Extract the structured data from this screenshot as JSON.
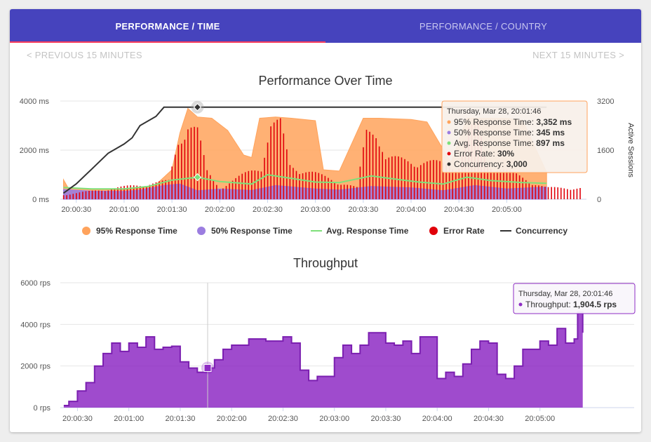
{
  "tabs": [
    {
      "label": "PERFORMANCE / TIME",
      "active": true
    },
    {
      "label": "PERFORMANCE / COUNTRY",
      "active": false
    }
  ],
  "pager": {
    "previous": "< PREVIOUS 15 MINUTES",
    "next": "NEXT 15 MINUTES >"
  },
  "colors": {
    "tab_bar": "#4643bd",
    "tab_indicator": "#ff3b5c",
    "p95": "#ffa35c",
    "p50": "#9b7de0",
    "avg": "#7ee07a",
    "error": "#e0000a",
    "concurrency": "#333333",
    "throughput": "#8e2cc4"
  },
  "legend_icons": {
    "p95": "circle-icon",
    "p50": "circle-icon",
    "avg": "line-icon",
    "error": "circle-icon",
    "concurrency": "line-icon"
  },
  "tooltips": {
    "performance": {
      "date": "Thursday, Mar 28, 20:01:46",
      "rows": [
        {
          "label": "95% Response Time: ",
          "value": "3,352 ms",
          "color": "#ffa35c"
        },
        {
          "label": "50% Response Time: ",
          "value": "345 ms",
          "color": "#9b7de0"
        },
        {
          "label": "Avg. Response Time: ",
          "value": "897 ms",
          "color": "#7ee07a"
        },
        {
          "label": "Error Rate: ",
          "value": "30%",
          "color": "#e0000a"
        },
        {
          "label": "Concurrency: ",
          "value": "3,000",
          "color": "#333333"
        }
      ]
    },
    "throughput": {
      "date": "Thursday, Mar 28, 20:01:46",
      "rows": [
        {
          "label": "Throughput: ",
          "value": "1,904.5 rps",
          "color": "#8e2cc4"
        }
      ]
    }
  },
  "chart_data": [
    {
      "type": "area",
      "title": "Performance Over Time",
      "x_tick_labels": [
        "20:00:30",
        "20:01:00",
        "20:01:30",
        "20:02:00",
        "20:02:30",
        "20:03:00",
        "20:03:30",
        "20:04:00",
        "20:04:30",
        "20:05:00"
      ],
      "y_left": {
        "unit": "ms",
        "tick_labels": [
          "0 ms",
          "2000 ms",
          "4000 ms"
        ],
        "ylim": [
          0,
          4000
        ]
      },
      "y_right": {
        "label": "Active Sessions",
        "tick_labels": [
          "0",
          "1600",
          "3200"
        ],
        "ylim": [
          0,
          3200
        ]
      },
      "x_range_seconds": [
        20,
        350
      ],
      "grid": true,
      "legend_position": "bottom",
      "legend": [
        {
          "key": "p95",
          "name": "95% Response Time"
        },
        {
          "key": "p50",
          "name": "50% Response Time"
        },
        {
          "key": "avg",
          "name": "Avg. Response Time"
        },
        {
          "key": "error",
          "name": "Error Rate"
        },
        {
          "key": "concurrency",
          "name": "Concurrency"
        }
      ],
      "series": [
        {
          "key": "p95",
          "name": "95% Response Time",
          "x": [
            "20:00:22",
            "20:00:25",
            "20:00:40",
            "20:01:00",
            "20:01:10",
            "20:01:20",
            "20:01:30",
            "20:01:35",
            "20:01:40",
            "20:01:46",
            "20:01:55",
            "20:02:05",
            "20:02:15",
            "20:02:20",
            "20:02:25",
            "20:02:35",
            "20:02:45",
            "20:03:00",
            "20:03:05",
            "20:03:15",
            "20:03:30",
            "20:03:40",
            "20:04:00",
            "20:04:10",
            "20:04:25",
            "20:04:35",
            "20:04:40",
            "20:05:00",
            "20:05:10",
            "20:05:25"
          ],
          "y": [
            800,
            450,
            400,
            400,
            450,
            600,
            1200,
            2700,
            3700,
            3352,
            3300,
            2800,
            1800,
            1700,
            3300,
            3350,
            3300,
            3200,
            1200,
            1150,
            3300,
            3300,
            3250,
            3150,
            1500,
            3300,
            3300,
            3300,
            3200,
            1100
          ]
        },
        {
          "key": "p50",
          "name": "50% Response Time",
          "x": [
            "20:00:22",
            "20:00:40",
            "20:01:00",
            "20:01:10",
            "20:01:25",
            "20:01:35",
            "20:01:46",
            "20:02:00",
            "20:02:20",
            "20:02:35",
            "20:03:00",
            "20:03:15",
            "20:03:35",
            "20:04:00",
            "20:04:20",
            "20:04:40",
            "20:05:00",
            "20:05:25"
          ],
          "y": [
            400,
            330,
            320,
            380,
            560,
            620,
            345,
            420,
            360,
            560,
            420,
            380,
            520,
            470,
            350,
            560,
            420,
            500
          ]
        },
        {
          "key": "avg",
          "name": "Avg. Response Time",
          "x": [
            "20:00:22",
            "20:00:40",
            "20:01:00",
            "20:01:15",
            "20:01:30",
            "20:01:46",
            "20:02:00",
            "20:02:20",
            "20:02:30",
            "20:02:45",
            "20:03:00",
            "20:03:15",
            "20:03:35",
            "20:03:50",
            "20:04:05",
            "20:04:20",
            "20:04:35",
            "20:04:50",
            "20:05:10",
            "20:05:25"
          ],
          "y": [
            480,
            420,
            420,
            520,
            780,
            897,
            720,
            620,
            1000,
            850,
            700,
            680,
            950,
            820,
            700,
            620,
            900,
            760,
            680,
            650
          ]
        },
        {
          "key": "error",
          "name": "Error Rate",
          "x": [
            "20:00:22",
            "20:01:28",
            "20:01:34",
            "20:01:40",
            "20:01:46",
            "20:01:52",
            "20:02:00",
            "20:02:26",
            "20:02:32",
            "20:02:38",
            "20:02:44",
            "20:03:26",
            "20:03:32",
            "20:03:38",
            "20:03:44",
            "20:04:30",
            "20:04:36",
            "20:04:42",
            "20:04:48",
            "20:05:25"
          ],
          "y": [
            2,
            8,
            26,
            34,
            30,
            12,
            5,
            15,
            32,
            33,
            15,
            5,
            30,
            32,
            18,
            15,
            30,
            32,
            16,
            5
          ]
        },
        {
          "key": "concurrency",
          "name": "Concurrency",
          "x": [
            "20:00:22",
            "20:00:30",
            "20:00:40",
            "20:00:50",
            "20:01:00",
            "20:01:05",
            "20:01:10",
            "20:01:20",
            "20:01:25",
            "20:01:30",
            "20:01:46",
            "20:05:25"
          ],
          "y": [
            200,
            500,
            1000,
            1500,
            1800,
            2000,
            2400,
            2700,
            3000,
            3000,
            3000,
            3000
          ]
        }
      ]
    },
    {
      "type": "area",
      "title": "Throughput",
      "x_tick_labels": [
        "20:00:30",
        "20:01:00",
        "20:01:30",
        "20:02:00",
        "20:02:30",
        "20:03:00",
        "20:03:30",
        "20:04:00",
        "20:04:30",
        "20:05:00"
      ],
      "y_left": {
        "unit": "rps",
        "tick_labels": [
          "0 rps",
          "2000 rps",
          "4000 rps",
          "6000 rps"
        ],
        "ylim": [
          0,
          6000
        ]
      },
      "x_range_seconds": [
        20,
        355
      ],
      "grid": true,
      "series": [
        {
          "key": "throughput",
          "name": "Throughput",
          "x": [
            "20:00:22",
            "20:00:25",
            "20:00:30",
            "20:00:35",
            "20:00:40",
            "20:00:45",
            "20:00:50",
            "20:00:55",
            "20:01:00",
            "20:01:05",
            "20:01:10",
            "20:01:15",
            "20:01:20",
            "20:01:25",
            "20:01:30",
            "20:01:35",
            "20:01:40",
            "20:01:46",
            "20:01:50",
            "20:01:55",
            "20:02:00",
            "20:02:10",
            "20:02:20",
            "20:02:30",
            "20:02:35",
            "20:02:40",
            "20:02:45",
            "20:02:50",
            "20:03:00",
            "20:03:05",
            "20:03:10",
            "20:03:15",
            "20:03:20",
            "20:03:30",
            "20:03:35",
            "20:03:40",
            "20:03:45",
            "20:03:50",
            "20:04:00",
            "20:04:05",
            "20:04:10",
            "20:04:15",
            "20:04:20",
            "20:04:25",
            "20:04:30",
            "20:04:35",
            "20:04:40",
            "20:04:45",
            "20:04:50",
            "20:05:00",
            "20:05:05",
            "20:05:10",
            "20:05:15",
            "20:05:20",
            "20:05:22",
            "20:05:25"
          ],
          "y": [
            100,
            300,
            800,
            1200,
            2000,
            2600,
            3100,
            2700,
            3100,
            2900,
            3400,
            2800,
            2900,
            2950,
            2200,
            1900,
            1700,
            1904.5,
            2300,
            2800,
            3000,
            3300,
            3200,
            3400,
            3100,
            1800,
            1300,
            1500,
            2400,
            3000,
            2600,
            3000,
            3600,
            3100,
            3000,
            3200,
            2600,
            3400,
            1400,
            1700,
            1500,
            2100,
            2800,
            3200,
            3100,
            1600,
            1400,
            2000,
            2800,
            3200,
            3000,
            3800,
            3100,
            3300,
            4600,
            3600
          ]
        }
      ]
    }
  ]
}
